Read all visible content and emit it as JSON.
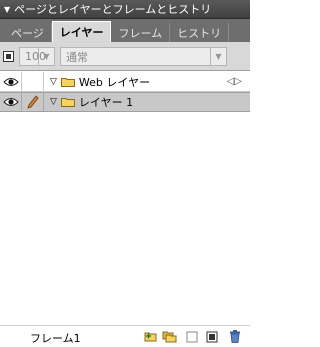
{
  "panel": {
    "title": "ページとレイヤーとフレームとヒストリ",
    "collapse_icon": "triangle-down-icon"
  },
  "tabs": [
    {
      "label": "ページ",
      "active": false
    },
    {
      "label": "レイヤー",
      "active": true
    },
    {
      "label": "フレーム",
      "active": false
    },
    {
      "label": "ヒストリ",
      "active": false
    }
  ],
  "toolbar": {
    "opacity_value": "100",
    "blend_mode": "通常"
  },
  "layers": [
    {
      "name": "Web レイヤー",
      "visible": true,
      "editable": false,
      "expanded": true,
      "selected": false,
      "icon": "folder-icon"
    },
    {
      "name": "レイヤー 1",
      "visible": true,
      "editable": true,
      "expanded": true,
      "selected": true,
      "icon": "folder-icon"
    }
  ],
  "footer": {
    "frame_label": "フレーム1",
    "buttons": [
      "new-sublayer-icon",
      "duplicate-layer-icon",
      "new-layer-icon",
      "add-mask-icon",
      "trash-icon"
    ]
  },
  "colors": {
    "titlebar": "#4a4a4a",
    "tabbar": "#6e6e6e",
    "active_tab": "#d8d8d8",
    "selected_row": "#c8c8c8",
    "folder": "#f4d35e",
    "pencil": "#d9822b"
  }
}
